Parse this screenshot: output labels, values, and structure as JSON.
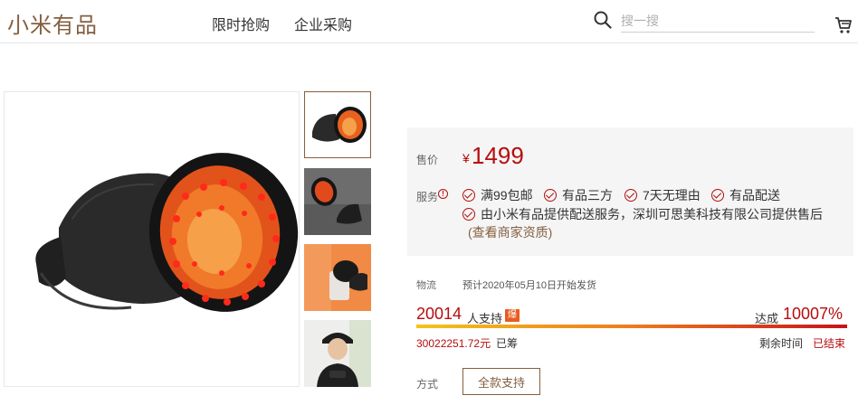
{
  "header": {
    "logo": "小米有品",
    "nav": [
      "限时抢购",
      "企业采购"
    ],
    "search_placeholder": "搜一搜",
    "search_icon": "search-icon",
    "cart_icon": "cart-icon"
  },
  "gallery": {
    "main_alt": "红光头盔帽",
    "thumbnails": [
      "thumb-1",
      "thumb-2",
      "thumb-3",
      "thumb-4"
    ]
  },
  "price": {
    "label": "售价",
    "currency": "¥",
    "value": "1499"
  },
  "service": {
    "label": "服务",
    "items": [
      "满99包邮",
      "有品三方",
      "7天无理由",
      "有品配送"
    ],
    "detail": "由小米有品提供配送服务，深圳可思美科技有限公司提供售后",
    "merchant_link": "(查看商家资质)"
  },
  "shipping": {
    "label": "物流",
    "text": "预计2020年05月10日开始发货"
  },
  "crowdfund": {
    "supporters": "20014",
    "supporters_unit": "人支持",
    "hot_badge": "爆",
    "achieve_label": "达成",
    "achieve_pct": "10007%",
    "progress_fraction": 1.0,
    "raised_amount": "30022251.72元",
    "raised_label": "已筹",
    "remaining_label": "剩余时间",
    "remaining_value": "已结束"
  },
  "mode": {
    "label": "方式",
    "button": "全款支持"
  },
  "colors": {
    "brand": "#845f3f",
    "price_red": "#b60d0d",
    "panel_bg": "#f5f5f5"
  }
}
